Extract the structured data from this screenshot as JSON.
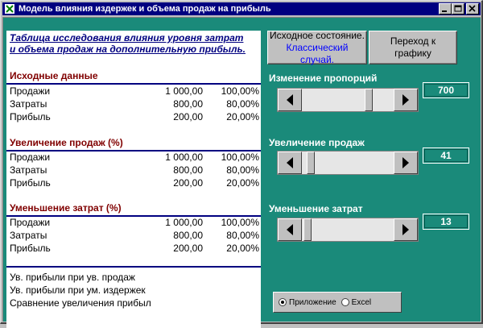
{
  "window": {
    "title": "Модель влияния  издержек и объема продаж на прибыль"
  },
  "table": {
    "title_line1": "Таблица исследования влияния уровня затрат",
    "title_line2": "и объема продаж на дополнительную прибыль.",
    "sections": [
      {
        "heading": "Исходные данные",
        "rows": [
          {
            "label": "Продажи",
            "value": "1 000,00",
            "pct": "100,00%"
          },
          {
            "label": "Затраты",
            "value": "800,00",
            "pct": "80,00%"
          },
          {
            "label": "Прибыль",
            "value": "200,00",
            "pct": "20,00%"
          }
        ]
      },
      {
        "heading": "Увеличение продаж (%)",
        "rows": [
          {
            "label": "Продажи",
            "value": "1 000,00",
            "pct": "100,00%"
          },
          {
            "label": "Затраты",
            "value": "800,00",
            "pct": "80,00%"
          },
          {
            "label": "Прибыль",
            "value": "200,00",
            "pct": "20,00%"
          }
        ]
      },
      {
        "heading": "Уменьшение затрат (%)",
        "rows": [
          {
            "label": "Продажи",
            "value": "1 000,00",
            "pct": "100,00%"
          },
          {
            "label": "Затраты",
            "value": "800,00",
            "pct": "80,00%"
          },
          {
            "label": "Прибыль",
            "value": "200,00",
            "pct": "20,00%"
          }
        ]
      }
    ],
    "summary": [
      "Ув. прибыли при ув. продаж",
      "Ув. прибыли при ум. издержек",
      "Сравнение увеличения прибыл"
    ]
  },
  "buttons": {
    "reset_line1": "Исходное состояние.",
    "reset_line2": "Классический случай.",
    "chart_line1": "Переход к",
    "chart_line2": "графику"
  },
  "controls": {
    "proportions": {
      "label": "Изменение пропорций",
      "value": "700"
    },
    "sales": {
      "label": "Увеличение продаж",
      "value": "41"
    },
    "costs": {
      "label": "Уменьшение затрат",
      "value": "13"
    }
  },
  "options": {
    "app_label": "Приложение",
    "excel_label": "Excel",
    "selected": "app"
  }
}
